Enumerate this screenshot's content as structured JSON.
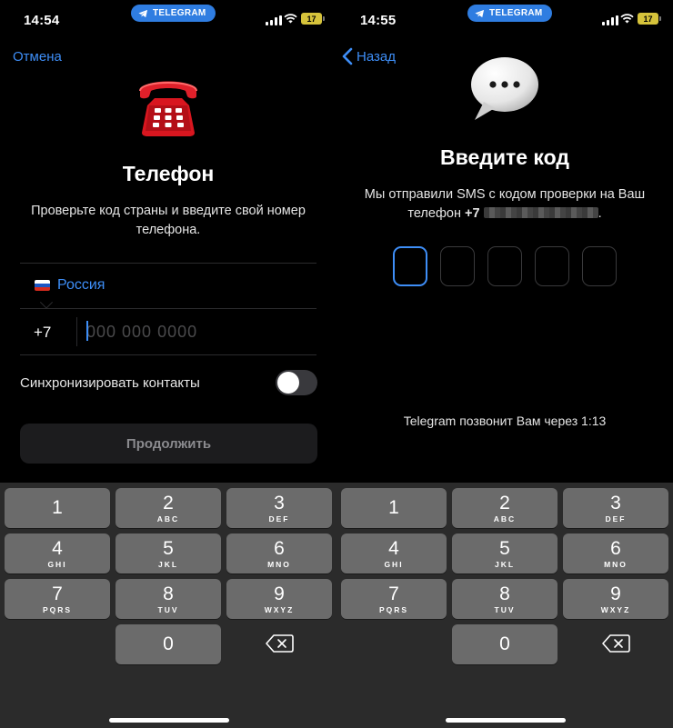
{
  "status": {
    "left_time": "14:54",
    "right_time": "14:55",
    "app_pill": "TELEGRAM",
    "battery": "17"
  },
  "phone_screen": {
    "cancel_label": "Отмена",
    "title": "Телефон",
    "subtitle": "Проверьте код страны и введите свой номер телефона.",
    "country_name": "Россия",
    "country_code": "+7",
    "phone_placeholder": "000 000 0000",
    "sync_label": "Синхронизировать контакты",
    "sync_enabled": false,
    "continue_label": "Продолжить"
  },
  "code_screen": {
    "back_label": "Назад",
    "title": "Введите код",
    "subtitle_text": "Мы отправили SMS с кодом проверки на Ваш телефон",
    "phone_prefix": "+7",
    "code_length": 5,
    "call_note": "Telegram позвонит Вам через 1:13"
  },
  "keypad": {
    "keys": [
      {
        "n": "1",
        "l": ""
      },
      {
        "n": "2",
        "l": "ABC"
      },
      {
        "n": "3",
        "l": "DEF"
      },
      {
        "n": "4",
        "l": "GHI"
      },
      {
        "n": "5",
        "l": "JKL"
      },
      {
        "n": "6",
        "l": "MNO"
      },
      {
        "n": "7",
        "l": "PQRS"
      },
      {
        "n": "8",
        "l": "TUV"
      },
      {
        "n": "9",
        "l": "WXYZ"
      },
      {
        "n": "0",
        "l": ""
      }
    ]
  },
  "colors": {
    "accent": "#3e8ef7",
    "pill": "#2f7de1",
    "key": "#6b6b6b",
    "keypad_bg": "#2b2b2b",
    "battery": "#d6c33b"
  }
}
